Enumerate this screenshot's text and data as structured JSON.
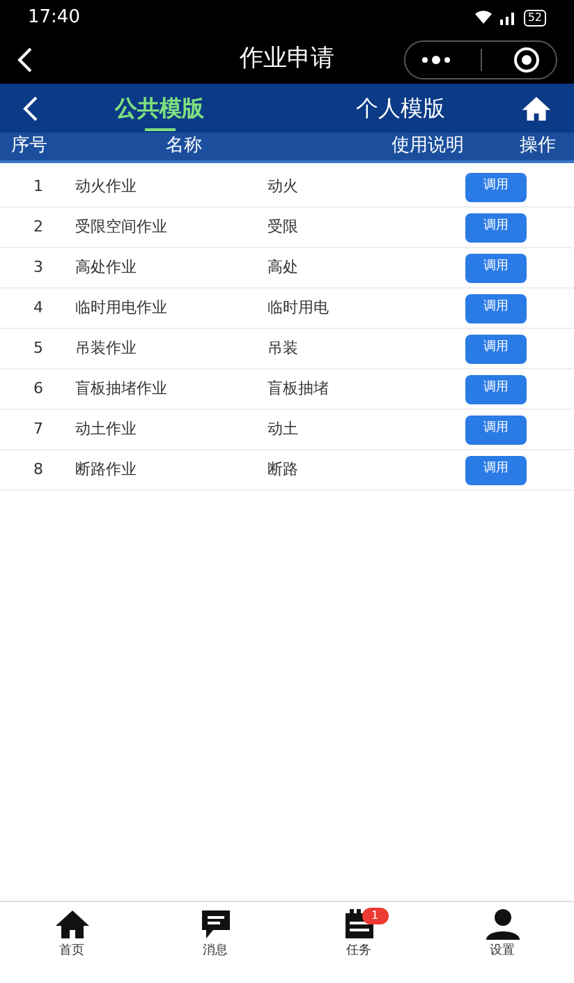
{
  "status_bar": {
    "time": "17:40",
    "battery": "52"
  },
  "nav_bar": {
    "title": "作业申请"
  },
  "tabs": [
    {
      "label": "公共模版",
      "selected": true
    },
    {
      "label": "个人模版",
      "selected": false
    }
  ],
  "table": {
    "columns": [
      "序号",
      "名称",
      "使用说明",
      "操作"
    ],
    "rows": [
      {
        "index": "1",
        "name": "动火作业",
        "note": "动火",
        "action": "调用"
      },
      {
        "index": "2",
        "name": "受限空间作业",
        "note": "受限",
        "action": "调用"
      },
      {
        "index": "3",
        "name": "高处作业",
        "note": "高处",
        "action": "调用"
      },
      {
        "index": "4",
        "name": "临时用电作业",
        "note": "临时用电",
        "action": "调用"
      },
      {
        "index": "5",
        "name": "吊装作业",
        "note": "吊装",
        "action": "调用"
      },
      {
        "index": "6",
        "name": "盲板抽堵作业",
        "note": "盲板抽堵",
        "action": "调用"
      },
      {
        "index": "7",
        "name": "动土作业",
        "note": "动土",
        "action": "调用"
      },
      {
        "index": "8",
        "name": "断路作业",
        "note": "断路",
        "action": "调用"
      }
    ]
  },
  "bottom_nav": [
    {
      "kind": "home",
      "label": "首页"
    },
    {
      "kind": "message",
      "label": "消息"
    },
    {
      "kind": "task",
      "label": "任务",
      "badge": "1"
    },
    {
      "kind": "user",
      "label": "设置"
    }
  ]
}
